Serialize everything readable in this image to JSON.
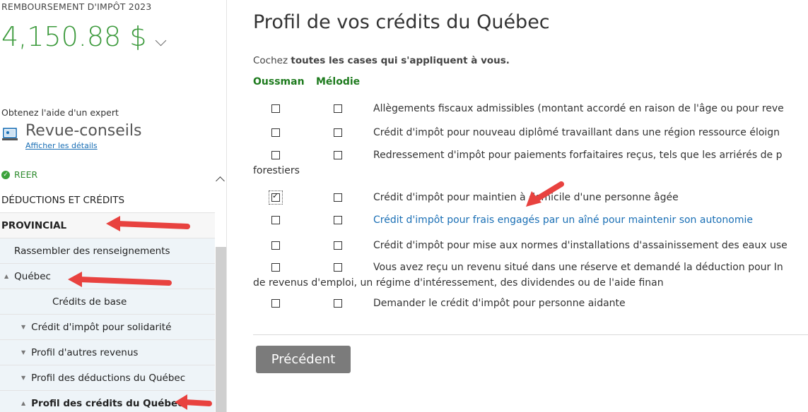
{
  "refund": {
    "label": "REMBOURSEMENT D'IMPÔT 2023",
    "amount": "4,150.88 $"
  },
  "expert": {
    "label": "Obtenez l'aide d'un expert",
    "title": "Revue-conseils",
    "link": "Afficher les détails"
  },
  "sidebar": {
    "reer": "REER",
    "section_header": "DÉDUCTIONS ET CRÉDITS",
    "provincial": "PROVINCIAL",
    "gather": "Rassembler des renseignements",
    "quebec": "Québec",
    "items": [
      "Crédits de base",
      "Crédit d'impôt pour solidarité",
      "Profil d'autres revenus",
      "Profil des déductions du Québec",
      "Profil des crédits du Québec"
    ]
  },
  "main": {
    "title": "Profil de vos crédits du Québec",
    "instruction_prefix": "Cochez ",
    "instruction_bold": "toutes les cases qui s'appliquent à vous.",
    "columns": [
      "Oussman",
      "Mélodie"
    ],
    "rows": [
      {
        "lines": [
          "Allègements fiscaux admissibles (montant accordé en raison de l'âge ou pour reve"
        ],
        "oussman": false,
        "melodie": false,
        "link": false
      },
      {
        "lines": [
          "Crédit d'impôt pour nouveau diplômé travaillant dans une région ressource éloign"
        ],
        "oussman": false,
        "melodie": false,
        "link": false
      },
      {
        "lines": [
          "Redressement d'impôt pour paiements forfaitaires reçus, tels que les arriérés de p",
          "forestiers"
        ],
        "oussman": false,
        "melodie": false,
        "link": false
      },
      {
        "lines": [
          "Crédit d'impôt pour maintien à domicile d'une personne âgée"
        ],
        "oussman": true,
        "melodie": false,
        "link": false
      },
      {
        "lines": [
          "Crédit d'impôt pour frais engagés par un aîné pour maintenir son autonomie"
        ],
        "oussman": false,
        "melodie": false,
        "link": true
      },
      {
        "lines": [
          "Crédit d'impôt pour mise aux normes d'installations d'assainissement des eaux use"
        ],
        "oussman": false,
        "melodie": false,
        "link": false
      },
      {
        "lines": [
          "Vous avez reçu un revenu situé dans une réserve et demandé la déduction pour In",
          "de revenus d'emploi, un régime d'intéressement, des dividendes ou de l'aide finan"
        ],
        "oussman": false,
        "melodie": false,
        "link": false
      },
      {
        "lines": [
          "Demander le crédit d'impôt pour personne aidante"
        ],
        "oussman": false,
        "melodie": false,
        "link": false
      }
    ],
    "prev_button": "Précédent"
  },
  "colors": {
    "green": "#3e9b3e",
    "link": "#1a6fb5",
    "arrow": "#e8423f",
    "button": "#7b7b7b"
  }
}
